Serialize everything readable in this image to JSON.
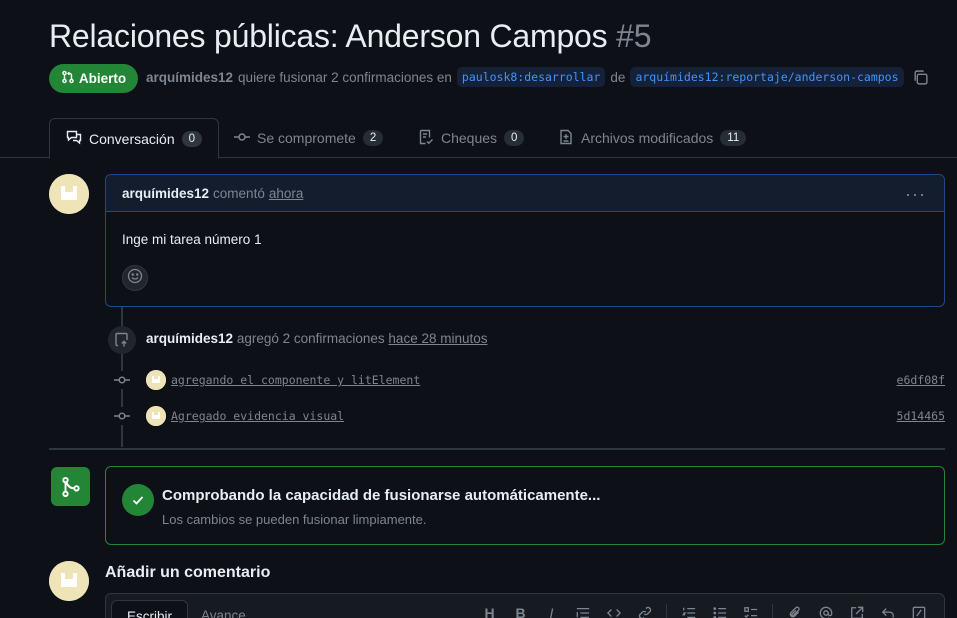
{
  "pr": {
    "title": "Relaciones públicas: Anderson Campos",
    "number": "#5",
    "state": "Abierto",
    "author": "arquímides12",
    "action_text": "quiere fusionar 2 confirmaciones en",
    "base_branch": "paulosk8:desarrollar",
    "from_text": "de",
    "head_branch": "arquímides12:reportaje/anderson-campos"
  },
  "tabs": [
    {
      "label": "Conversación",
      "count": "0"
    },
    {
      "label": "Se compromete",
      "count": "2"
    },
    {
      "label": "Cheques",
      "count": "0"
    },
    {
      "label": "Archivos modificados",
      "count": "11"
    }
  ],
  "comment": {
    "author": "arquímides12",
    "verb": "comentó",
    "when": "ahora",
    "body": "Inge mi tarea número 1"
  },
  "event": {
    "author": "arquímides12",
    "text": "agregó 2 confirmaciones",
    "when": "hace 28 minutos"
  },
  "commits": [
    {
      "message": "agregando el componente y litElement",
      "sha": "e6df08f"
    },
    {
      "message": "Agregado evidencia visual",
      "sha": "5d14465"
    }
  ],
  "merge": {
    "title": "Comprobando la capacidad de fusionarse automáticamente...",
    "subtitle": "Los cambios se pueden fusionar limpiamente."
  },
  "add_comment": {
    "title": "Añadir un comentario",
    "tab_write": "Escribir",
    "tab_preview": "Avance"
  },
  "colors": {
    "background": "#0d1117",
    "success": "#238636",
    "accent_blue": "#4493f8",
    "muted": "#7d8590"
  }
}
